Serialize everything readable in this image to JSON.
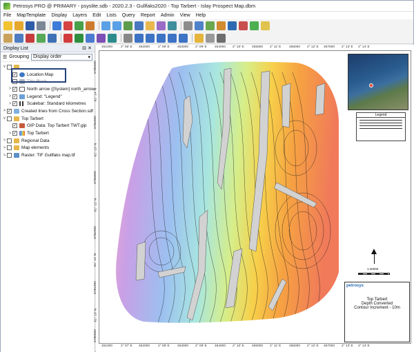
{
  "window": {
    "title": "Petrosys PRO @ PRIMARY - psyslite.sdb - 2020.2.3 - Gullfaks2020 - Top Tarbert - Islay Prospect Map.dbm"
  },
  "menu": [
    "File",
    "MapTemplate",
    "Display",
    "Layers",
    "Edit",
    "Lists",
    "Query",
    "Report",
    "Admin",
    "View",
    "Help"
  ],
  "panel": {
    "title": "Display List",
    "grouping_label": "Grouping",
    "grouping_value": "Display order"
  },
  "tree": [
    {
      "arrow": "v",
      "check": "",
      "label": ""
    },
    {
      "arrow": "",
      "check": "✓",
      "label": "Location Map"
    },
    {
      "arrow": "",
      "check": "",
      "label": "Title Block"
    },
    {
      "arrow": ">",
      "check": "✓",
      "label": "North arrow ([System] north_arrow"
    },
    {
      "arrow": ">",
      "check": "✓",
      "label": "Legend: \"Legend\""
    },
    {
      "arrow": ">",
      "check": "✓",
      "label": "Scalebar: Standard kilometres"
    },
    {
      "arrow": ">",
      "check": "✓",
      "label": "Created lines from Cross Section.sdf"
    },
    {
      "arrow": "v",
      "check": "",
      "label": "Top Tarbert"
    },
    {
      "arrow": "",
      "check": "✓",
      "label": "GIP Data: Top Tarbert TWT.gip"
    },
    {
      "arrow": ">",
      "check": "✓",
      "label": "Top Tarbert"
    },
    {
      "arrow": ">",
      "check": "",
      "label": "Regional Data"
    },
    {
      "arrow": ">",
      "check": "",
      "label": "Map elements"
    },
    {
      "arrow": ">",
      "check": "",
      "label": "Raster: TIF Gullfaks map.tif"
    }
  ],
  "axis": {
    "top_e": [
      "451000",
      "2° 06' E",
      "452000",
      "2° 08' E",
      "453000",
      "2° 09' E",
      "454000",
      "2° 10' E",
      "455000",
      "2° 11' E",
      "456000",
      "2° 12' E",
      "457000",
      "2° 13' E",
      "2° 14' E"
    ],
    "bottom_e": [
      "451000",
      "2° 07' E",
      "452000",
      "2° 08' E",
      "453000",
      "2° 09' E",
      "454000",
      "2° 10' E",
      "455000",
      "2° 11' E",
      "456000",
      "2° 12' E",
      "457000",
      "2° 13' E",
      "2° 14' E"
    ],
    "left_n": [
      "6785000",
      "61° 14' N",
      "6784000",
      "61° 13' N",
      "6783000",
      "61° 12' N",
      "6782000",
      "61° 11' N",
      "6781000",
      "61° 10' N",
      "6780000"
    ]
  },
  "legend": {
    "title": "Legend"
  },
  "scale": {
    "label": "1:40000"
  },
  "title_block": {
    "company": "petrosys",
    "line1": "Top Tarbert",
    "line2": "Depth Converted",
    "line3": "Contour Increment - 10m"
  }
}
